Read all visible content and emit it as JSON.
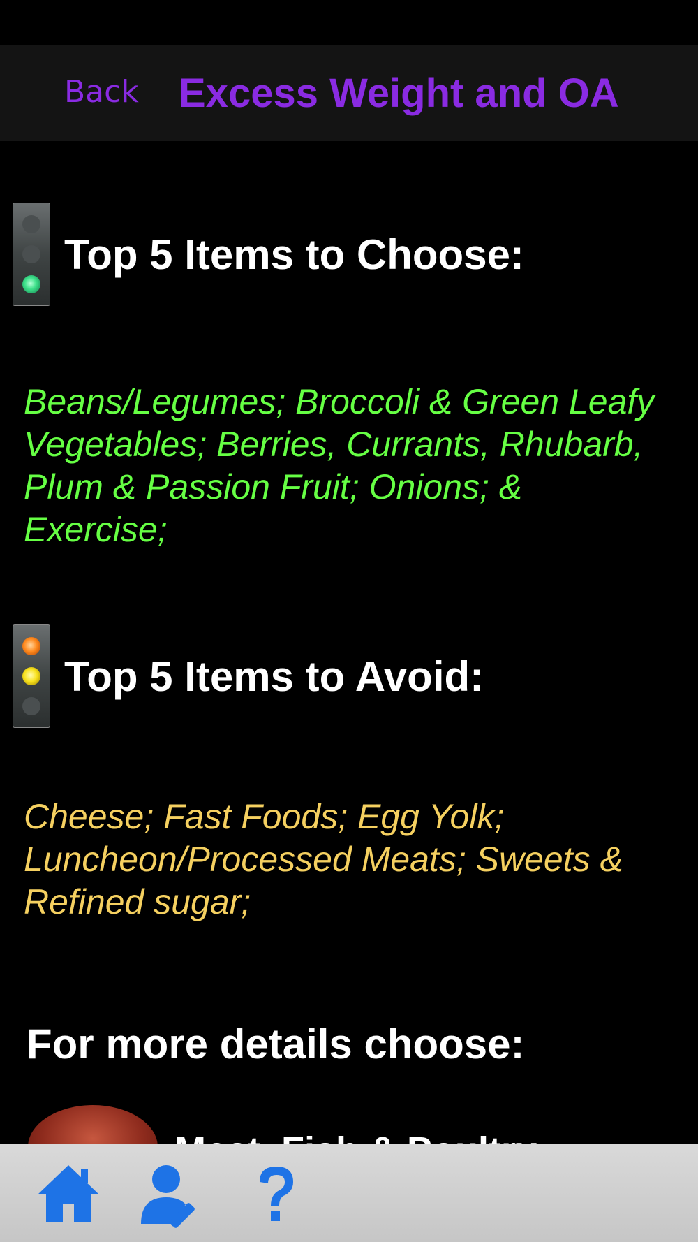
{
  "nav": {
    "back_label": "Back",
    "title": "Excess Weight and OA"
  },
  "choose": {
    "title": "Top 5 Items to Choose:",
    "text": "Beans/Legumes; Broccoli & Green Leafy Vegetables; Berries, Currants, Rhubarb, Plum & Passion Fruit; Onions; & Exercise;",
    "icon": "traffic-light-green-icon"
  },
  "avoid": {
    "title": "Top 5 Items to Avoid:",
    "text": "Cheese; Fast Foods; Egg Yolk; Luncheon/Processed Meats; Sweets & Refined sugar;",
    "icon": "traffic-light-amber-icon"
  },
  "more": {
    "title": "For more details choose:",
    "first_item_label": "Meat, Fish & Poultry"
  },
  "tabbar": {
    "items": [
      {
        "icon": "home-icon"
      },
      {
        "icon": "profile-edit-icon"
      },
      {
        "icon": "help-icon"
      }
    ],
    "icon_color": "#1e73e6"
  },
  "colors": {
    "accent": "#8a2be2",
    "choose_text": "#66ff44",
    "avoid_text": "#f5d060"
  }
}
